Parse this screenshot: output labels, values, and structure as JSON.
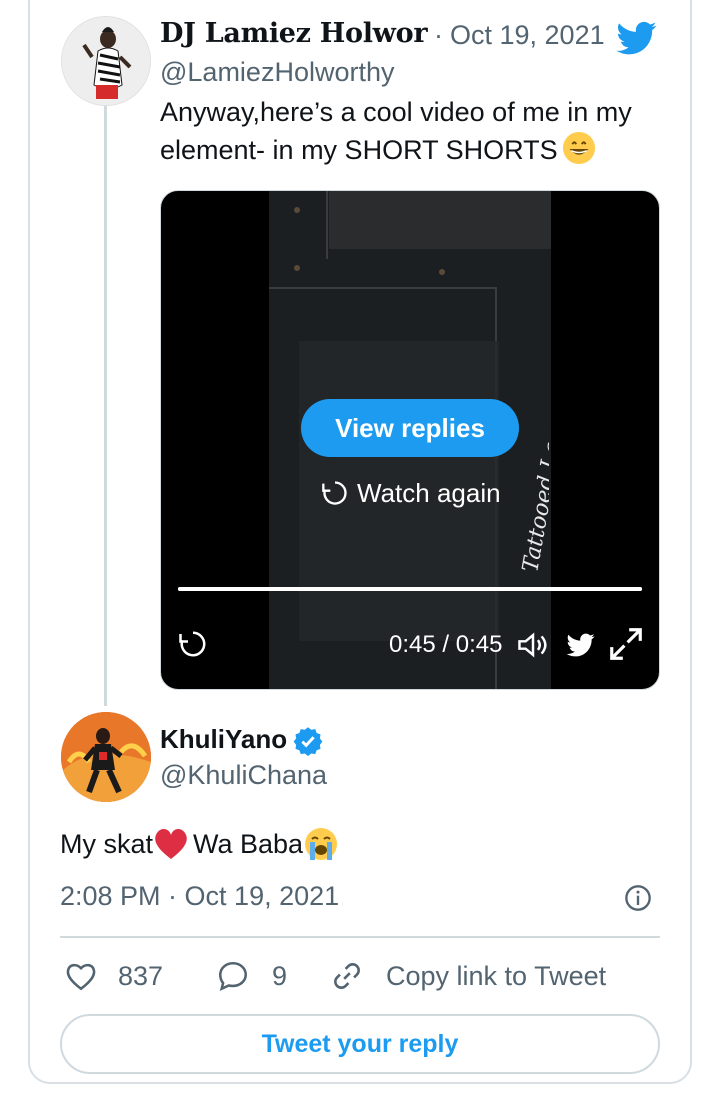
{
  "quoted_tweet": {
    "author_name": "DJ Lamiez Holworth",
    "separator": "·",
    "date": "Oct 19, 2021",
    "handle": "@LamiezHolworthy",
    "text": "Anyway,here’s a cool video of me in my element- in my SHORT SHORTS",
    "emoji": "grinning-face-with-smiling-eyes",
    "video": {
      "view_replies_label": "View replies",
      "watch_again_label": "Watch again",
      "time_display": "0:45 / 0:45",
      "progress_fraction": 1.0,
      "watermark_text": "Tattooed Lady"
    }
  },
  "main_tweet": {
    "author_name": "KhuliYano",
    "verified": true,
    "handle": "@KhuliChana",
    "text_part1": "My skat",
    "text_part2": " Wa Baba",
    "emojis": [
      "red-heart",
      "loudly-crying-face"
    ],
    "timestamp": "2:08 PM · Oct 19, 2021",
    "likes": "837",
    "replies": "9",
    "copy_link_label": "Copy link to Tweet",
    "reply_button_label": "Tweet your reply"
  },
  "colors": {
    "brand_blue": "#1d9bf0",
    "secondary_text": "#536471",
    "border": "#cfd9de"
  }
}
